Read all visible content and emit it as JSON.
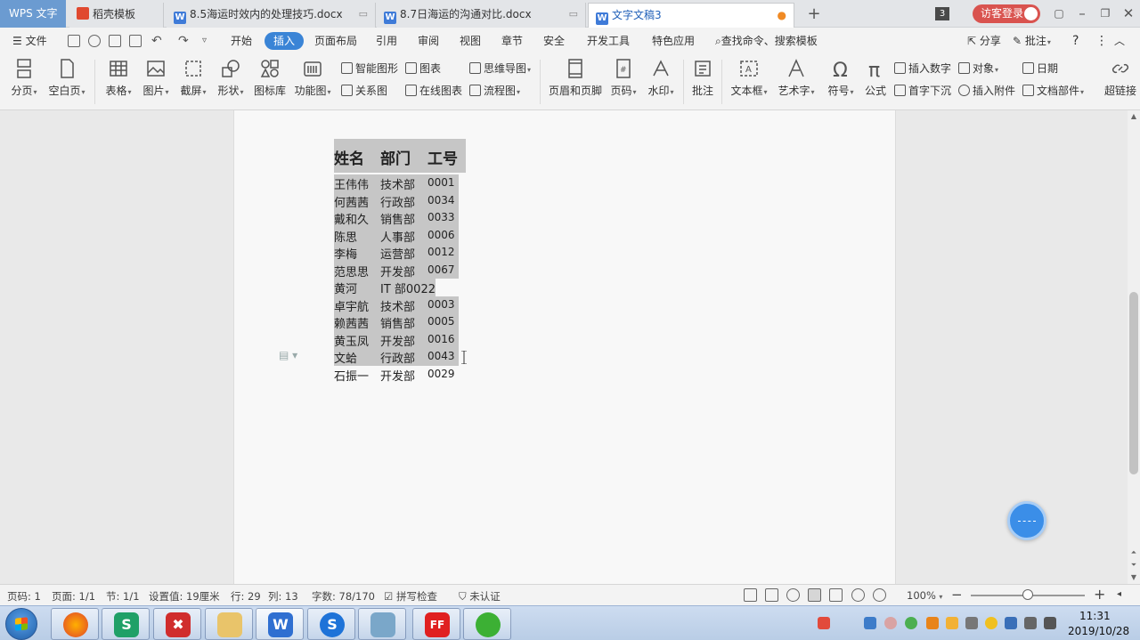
{
  "titlebar": {
    "app_tab": "WPS 文字",
    "tabs": [
      {
        "label": "稻壳模板",
        "icon": "docer-icon"
      },
      {
        "label": "8.5海运时效内的处理技巧.docx",
        "icon": "wps-writer-icon"
      },
      {
        "label": "8.7日海运的沟通对比.docx",
        "icon": "wps-writer-icon"
      },
      {
        "label": "文字文稿3",
        "icon": "wps-writer-icon",
        "active": true
      }
    ],
    "new_tab": "+",
    "tab_count": "3",
    "login": "访客登录"
  },
  "menubar": {
    "file": "文件",
    "tabs": [
      "开始",
      "插入",
      "页面布局",
      "引用",
      "审阅",
      "视图",
      "章节",
      "安全",
      "开发工具",
      "特色应用"
    ],
    "active_tab": "插入",
    "search": "查找命令、搜索模板",
    "share": "分享",
    "comment": "批注",
    "help": "?"
  },
  "ribbon": {
    "page_break": "分页",
    "blank_page": "空白页",
    "table": "表格",
    "picture": "图片",
    "screenshot": "截屏",
    "shape": "形状",
    "icon_lib": "图标库",
    "func_chart": "功能图",
    "smart_art": "智能图形",
    "chart": "图表",
    "mind_map": "思维导图",
    "relation": "关系图",
    "online_chart": "在线图表",
    "flowchart": "流程图",
    "header_footer": "页眉和页脚",
    "page_number": "页码",
    "watermark": "水印",
    "annotation": "批注",
    "text_box": "文本框",
    "art_text": "艺术字",
    "symbol": "符号",
    "formula": "公式",
    "insert_number": "插入数字",
    "object": "对象",
    "date": "日期",
    "drop_cap": "首字下沉",
    "attachment": "插入附件",
    "doc_parts": "文档部件",
    "hyperlink": "超链接"
  },
  "document": {
    "headers": [
      "姓名",
      "部门",
      "工号"
    ],
    "rows": [
      {
        "name": "王伟伟",
        "dept": "技术部",
        "id": "0001"
      },
      {
        "name": "何茜茜",
        "dept": "行政部",
        "id": "0034"
      },
      {
        "name": "戴和久",
        "dept": "销售部",
        "id": "0033"
      },
      {
        "name": "陈思",
        "dept": "人事部",
        "id": "0006"
      },
      {
        "name": "李梅",
        "dept": "运营部",
        "id": "0012"
      },
      {
        "name": "范思思",
        "dept": "开发部",
        "id": "0067"
      },
      {
        "name": "黄河",
        "dept": "IT 部0022",
        "id": ""
      },
      {
        "name": "卓宇航",
        "dept": "技术部",
        "id": "0003"
      },
      {
        "name": "赖茜茜",
        "dept": "销售部",
        "id": "0005"
      },
      {
        "name": "黄玉凤",
        "dept": "开发部",
        "id": "0016"
      },
      {
        "name": "文蛤",
        "dept": "行政部",
        "id": "0043"
      },
      {
        "name": "石振一",
        "dept": "开发部",
        "id": "0029"
      }
    ],
    "selected_rows": 11
  },
  "statusbar": {
    "page_code": "页码: 1",
    "page": "页面: 1/1",
    "section": "节: 1/1",
    "setting": "设置值: 19厘米",
    "row": "行: 29",
    "col": "列: 13",
    "word_count": "字数: 78/170",
    "spell_check": "拼写检查",
    "unverified": "未认证",
    "zoom": "100%",
    "zoom_minus": "−",
    "zoom_plus": "+",
    "zoom_level": 0.5
  },
  "taskbar": {
    "time": "11:31",
    "date": "2019/10/28"
  },
  "colors": {
    "accent": "#3a84d6",
    "selection": "#c6c6c6",
    "login": "#d9534f"
  }
}
